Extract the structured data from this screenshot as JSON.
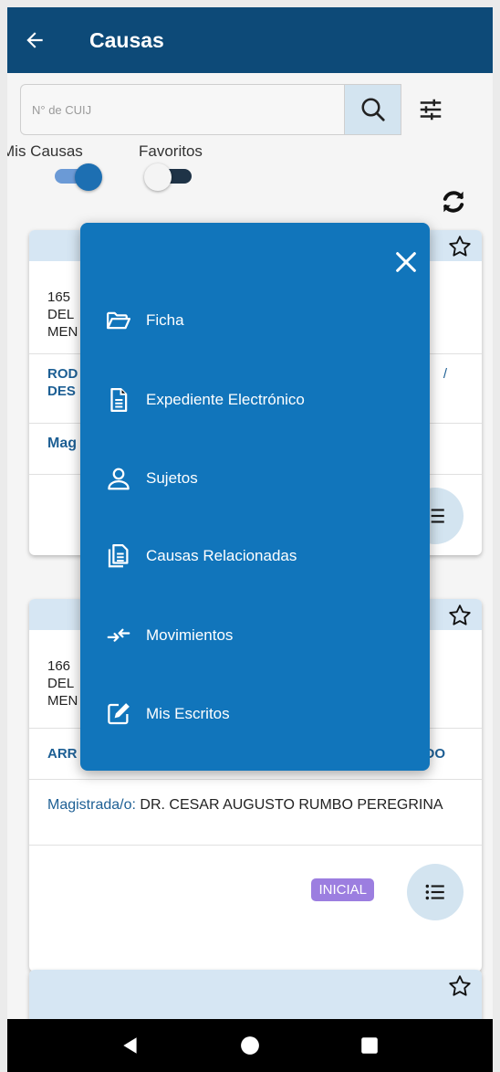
{
  "appbar": {
    "title": "Causas",
    "back_icon": "arrow-left-icon"
  },
  "search": {
    "placeholder": "N° de CUIJ",
    "value": ""
  },
  "toggles": {
    "mis_causas": {
      "label": "Mis Causas",
      "on": true
    },
    "favoritos": {
      "label": "Favoritos",
      "on": false
    }
  },
  "colors": {
    "appbar": "#0d4a78",
    "menu": "#1175bb",
    "accent": "#1d5f94",
    "badge": "#9c7ee0"
  },
  "cards": [
    {
      "body_lines": [
        "165",
        "DEL",
        "MEN"
      ],
      "parties": [
        "ROD",
        "DES"
      ],
      "parties_tail": "/",
      "magistrate_label": "Mag"
    },
    {
      "body_lines": [
        "166",
        "DEL",
        "MEN"
      ],
      "parties": [
        "ARR"
      ],
      "parties_tail": "DO",
      "magistrate_label": "Magistrada/o:",
      "magistrate_name": "DR. CESAR AUGUSTO RUMBO PEREGRINA",
      "badge": "INICIAL"
    }
  ],
  "menu": {
    "items": [
      {
        "label": "Ficha",
        "icon": "folder-open-icon"
      },
      {
        "label": "Expediente Electrónico",
        "icon": "document-icon"
      },
      {
        "label": "Sujetos",
        "icon": "person-icon"
      },
      {
        "label": "Causas Relacionadas",
        "icon": "documents-stack-icon"
      },
      {
        "label": "Movimientos",
        "icon": "arrows-exchange-icon"
      },
      {
        "label": "Mis Escritos",
        "icon": "edit-icon"
      }
    ]
  }
}
